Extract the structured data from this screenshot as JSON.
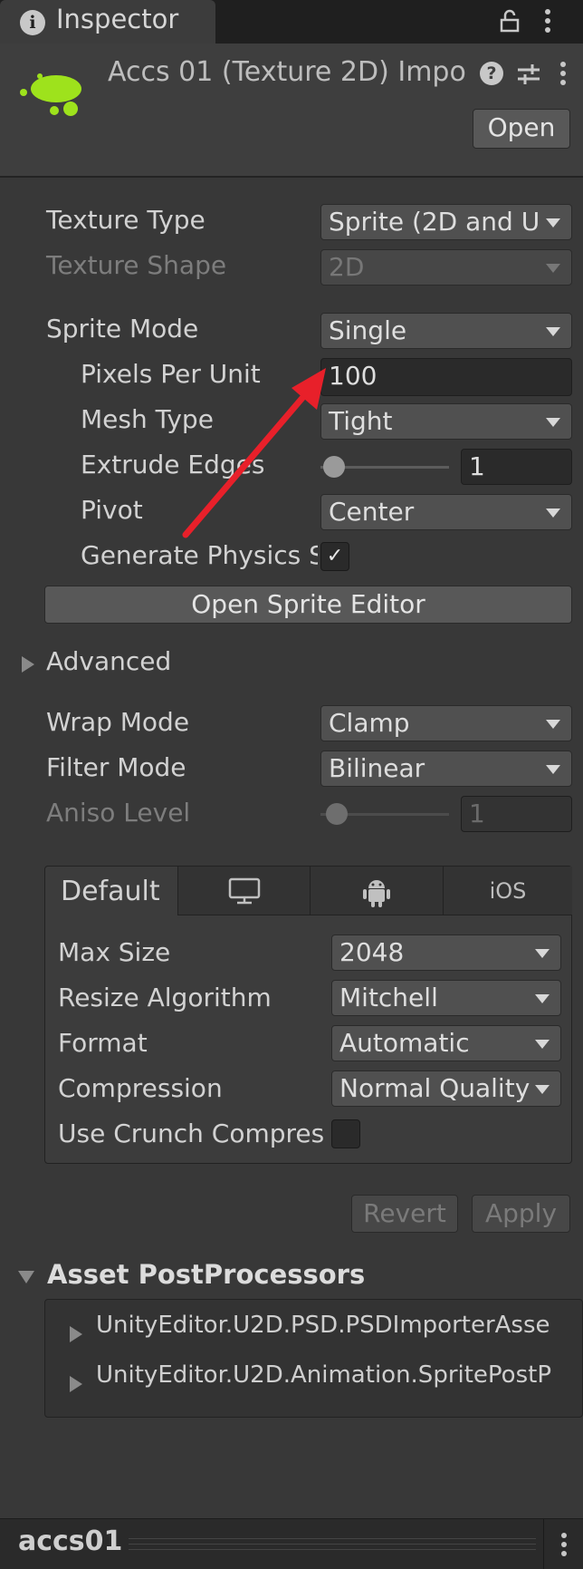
{
  "tab": {
    "title": "Inspector"
  },
  "header": {
    "title": "Accs 01 (Texture 2D) Impo",
    "open_button": "Open"
  },
  "fields": {
    "texture_type": {
      "label": "Texture Type",
      "value": "Sprite (2D and U"
    },
    "texture_shape": {
      "label": "Texture Shape",
      "value": "2D"
    },
    "sprite_mode": {
      "label": "Sprite Mode",
      "value": "Single"
    },
    "pixels_per_unit": {
      "label": "Pixels Per Unit",
      "value": "100"
    },
    "mesh_type": {
      "label": "Mesh Type",
      "value": "Tight"
    },
    "extrude_edges": {
      "label": "Extrude Edges",
      "value": "1"
    },
    "pivot": {
      "label": "Pivot",
      "value": "Center"
    },
    "generate_physics": {
      "label": "Generate Physics S",
      "checked": true
    },
    "open_sprite_editor": "Open Sprite Editor",
    "advanced": "Advanced",
    "wrap_mode": {
      "label": "Wrap Mode",
      "value": "Clamp"
    },
    "filter_mode": {
      "label": "Filter Mode",
      "value": "Bilinear"
    },
    "aniso_level": {
      "label": "Aniso Level",
      "value": "1"
    }
  },
  "platform": {
    "tabs": {
      "default": "Default",
      "ios": "iOS"
    },
    "max_size": {
      "label": "Max Size",
      "value": "2048"
    },
    "resize_algorithm": {
      "label": "Resize Algorithm",
      "value": "Mitchell"
    },
    "format": {
      "label": "Format",
      "value": "Automatic"
    },
    "compression": {
      "label": "Compression",
      "value": "Normal Quality"
    },
    "use_crunch": {
      "label": "Use Crunch Compres",
      "checked": false
    }
  },
  "actions": {
    "revert": "Revert",
    "apply": "Apply"
  },
  "post_processors": {
    "title": "Asset PostProcessors",
    "items": [
      "UnityEditor.U2D.PSD.PSDImporterAsse",
      "UnityEditor.U2D.Animation.SpritePostP"
    ]
  },
  "footer": {
    "asset_name": "accs01"
  },
  "colors": {
    "background": "#383838",
    "annotation_arrow": "#e8202a",
    "sprite_icon": "#9ee21c"
  },
  "annotation": {
    "type": "arrow",
    "points_to": "pixels-per-unit-field"
  }
}
